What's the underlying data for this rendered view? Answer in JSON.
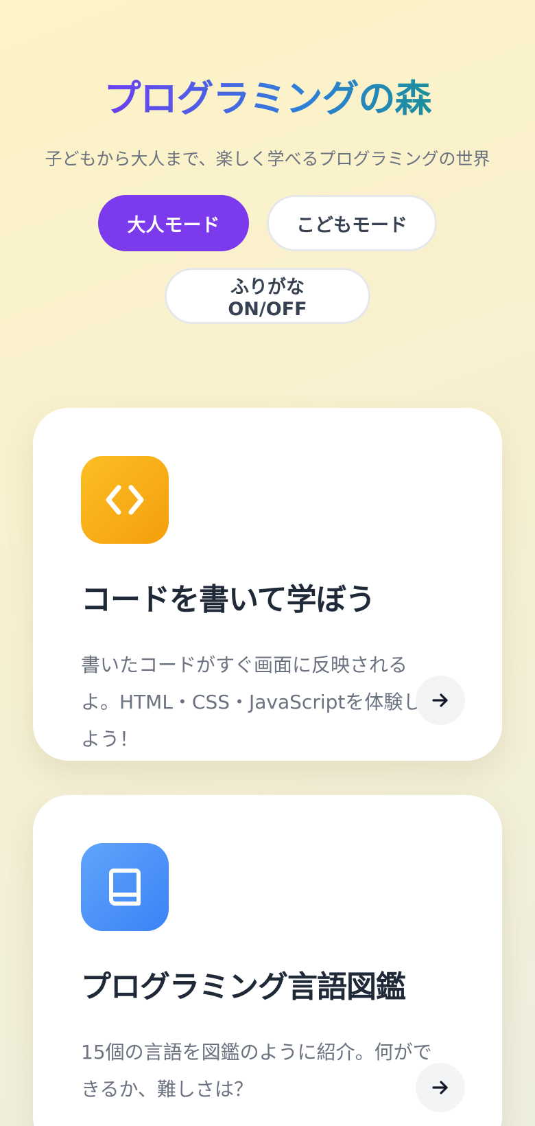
{
  "header": {
    "title": "プログラミングの森",
    "subtitle": "子どもから大人まで、楽しく学べるプログラミングの世界"
  },
  "modes": {
    "adult_label": "大人モード",
    "kids_label": "こどもモード",
    "furigana_label": "ふりがな ON/OFF",
    "active": "adult"
  },
  "cards": [
    {
      "icon": "code-icon",
      "title": "コードを書いて学ぼう",
      "description": "書いたコードがすぐ画面に反映されるよ。HTML・CSS・JavaScriptを体験しよう！",
      "arrow_icon": "arrow-right-icon"
    },
    {
      "icon": "book-icon",
      "title": "プログラミング言語図鑑",
      "description": "15個の言語を図鑑のように紹介。何ができるか、難しさは？",
      "arrow_icon": "arrow-right-icon"
    }
  ],
  "colors": {
    "accent": "#7c3aed",
    "code_icon_bg": "#f59e0b",
    "book_icon_bg": "#3b82f6",
    "title_gradient_start": "#6d3ff0",
    "title_gradient_end": "#1b8f9c"
  }
}
